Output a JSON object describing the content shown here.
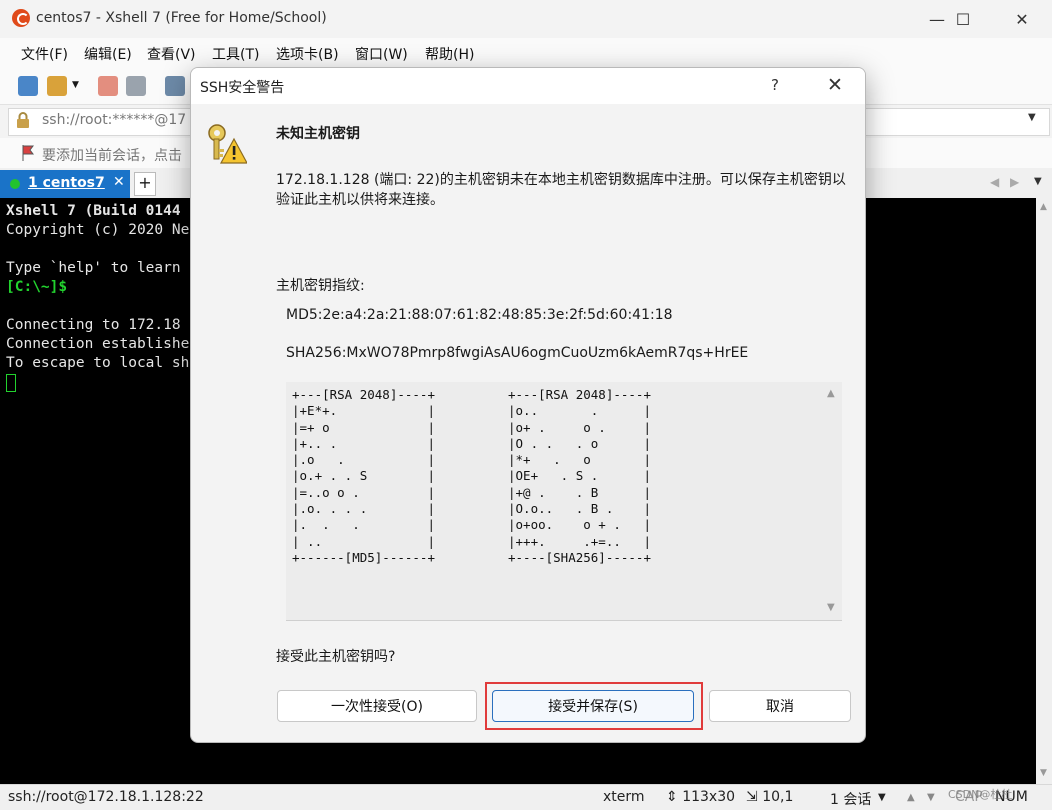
{
  "window": {
    "title": "centos7 - Xshell 7 (Free for Home/School)",
    "minimize": "—",
    "maximize": "☐",
    "close": "✕"
  },
  "menu": [
    "文件(F)",
    "编辑(E)",
    "查看(V)",
    "工具(T)",
    "选项卡(B)",
    "窗口(W)",
    "帮助(H)"
  ],
  "address": {
    "text": "ssh://root:******@17"
  },
  "hint": {
    "text": "要添加当前会话，点击"
  },
  "tab": {
    "label": "1 centos7",
    "close": "✕",
    "add": "+"
  },
  "terminal": {
    "lines": [
      "Xshell 7 (Build 0144",
      "Copyright (c) 2020 Ne",
      "",
      "Type `help' to learn",
      "[C:\\~]$",
      "",
      "Connecting to 172.18",
      "Connection establishe",
      "To escape to local sh"
    ],
    "prompt_color": "#22d22e"
  },
  "status": {
    "connection": "ssh://root@172.18.1.128:22",
    "term": "xterm",
    "size": "113x30",
    "pos": "10,1",
    "sessions": "1 会话",
    "caps": "CAP",
    "num": "NUM",
    "watermark": "CSDN@杜杜"
  },
  "dialog": {
    "title": "SSH安全警告",
    "help": "?",
    "close": "✕",
    "heading": "未知主机密钥",
    "message": "172.18.1.128 (端口: 22)的主机密钥未在本地主机密钥数据库中注册。可以保存主机密钥以验证此主机以供将来连接。",
    "fingerprint_label": "主机密钥指纹:",
    "md5": "MD5:2e:a4:2a:21:88:07:61:82:48:85:3e:2f:5d:60:41:18",
    "sha256": "SHA256:MxWO78Pmrp8fwgiAsAU6ogmCuoUzm6kAemR7qs+HrEE",
    "randomart_md5": "+---[RSA 2048]----+\n|+E*+.            |\n|=+ o             |\n|+.. .            |\n|.o   .           |\n|o.+ . . S        |\n|=..o o .         |\n|.o. . . .        |\n|.  .   .         |\n| ..              |\n+------[MD5]------+",
    "randomart_sha256": "+---[RSA 2048]----+\n|o..       .      |\n|o+ .     o .     |\n|O . .   . o      |\n|*+   .   o       |\n|OE+   . S .      |\n|+@ .    . B      |\n|O.o..   . B .    |\n|o+oo.    o + .   |\n|+++.     .+=..   |\n+----[SHA256]-----+",
    "question": "接受此主机密钥吗?",
    "buttons": {
      "accept_once": "一次性接受(O)",
      "accept_save": "接受并保存(S)",
      "cancel": "取消"
    },
    "highlight_color": "#e03b3b"
  }
}
